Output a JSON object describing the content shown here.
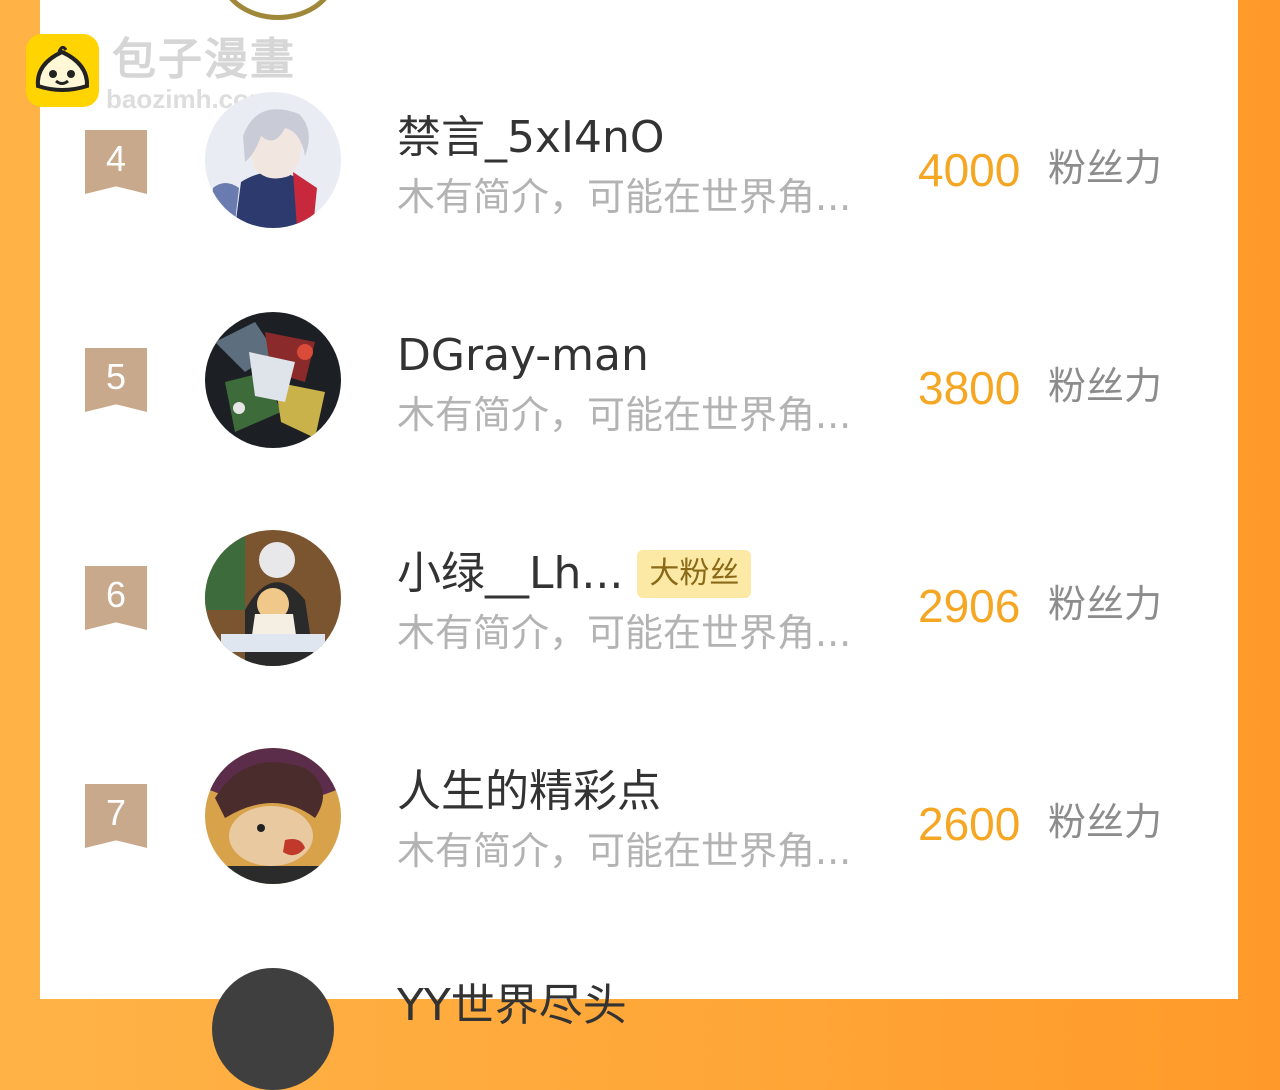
{
  "watermark": {
    "title": "包子漫畫",
    "url": "baozimh.com"
  },
  "ranking": {
    "unit_label": "粉丝力",
    "rows": [
      {
        "rank": "4",
        "name": "禁言_5xI4nO",
        "description": "木有简介，可能在世界角...",
        "score": "4000",
        "tag": "",
        "avatar_icon": "anime-avatar-silver-hair"
      },
      {
        "rank": "5",
        "name": "DGray-man",
        "description": "木有简介，可能在世界角...",
        "score": "3800",
        "tag": "",
        "avatar_icon": "robots-collage-avatar"
      },
      {
        "rank": "6",
        "name": "小绿__Lh...",
        "description": "木有简介，可能在世界角...",
        "score": "2906",
        "tag": "大粉丝",
        "avatar_icon": "anime-avatar-two-characters"
      },
      {
        "rank": "7",
        "name": "人生的精彩点",
        "description": "木有简介，可能在世界角...",
        "score": "2600",
        "tag": "",
        "avatar_icon": "hedgehog-cartoon-avatar"
      }
    ],
    "partial_next_name": "YY世界尽头"
  },
  "colors": {
    "background_gradient": [
      "#ffb347",
      "#ff9a2a"
    ],
    "rank_badge": "#c8a98c",
    "score": "#f5a623",
    "tag_bg": "#fde9a6",
    "tag_text": "#8a6a18",
    "desc_text": "#b3b3b3"
  }
}
